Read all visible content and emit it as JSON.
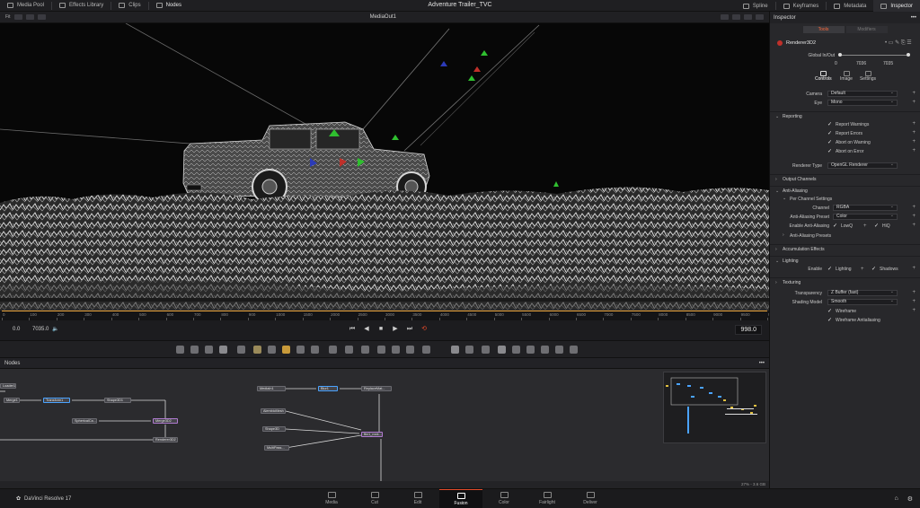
{
  "topbar": {
    "items": [
      {
        "label": "Media Pool",
        "icon": "media-pool-icon"
      },
      {
        "label": "Effects Library",
        "icon": "effects-library-icon"
      },
      {
        "label": "Clips",
        "icon": "clips-icon"
      },
      {
        "label": "Nodes",
        "icon": "nodes-icon"
      }
    ],
    "project_title": "Adventure Trailer_TVC",
    "right_items": [
      {
        "label": "Spline",
        "icon": "spline-icon"
      },
      {
        "label": "Keyframes",
        "icon": "keyframes-icon"
      },
      {
        "label": "Metadata",
        "icon": "metadata-icon"
      },
      {
        "label": "Inspector",
        "icon": "inspector-icon"
      }
    ]
  },
  "viewer": {
    "zoom_label": "Fit",
    "title": "MediaOut1"
  },
  "ruler": {
    "ticks": [
      "0",
      "100",
      "200",
      "300",
      "400",
      "500",
      "600",
      "700",
      "800",
      "900",
      "1000",
      "1500",
      "2000",
      "2500",
      "3000",
      "3500",
      "4000",
      "4500",
      "5000",
      "5500",
      "6000",
      "6500",
      "7000",
      "7500",
      "8000",
      "8500",
      "9000",
      "9500",
      "9800"
    ]
  },
  "transport": {
    "start": "0.0",
    "end": "7035.0",
    "current": "998.0"
  },
  "nodes_panel": {
    "title": "Nodes",
    "nodes": [
      "Loader1",
      "Merge1",
      "Transform1",
      "Shape3D1",
      "Merge3D2",
      "SphericalCa...",
      "Renderer3D2",
      "MediaIn1",
      "Blur1",
      "ReplaceMat...",
      "AlembicMesh",
      "Shape3D",
      "MultiPass...",
      "fbx1_rock..."
    ],
    "status": "27% - 3.6 GB"
  },
  "inspector": {
    "title": "Inspector",
    "tabs": [
      "Tools",
      "Modifiers"
    ],
    "node_name": "Renderer3D2",
    "global_label": "Global In/Out",
    "global_vals": [
      "0",
      "7036",
      "7035"
    ],
    "subtabs": [
      "Controls",
      "Image",
      "Settings"
    ],
    "camera_label": "Camera",
    "camera_value": "Default",
    "eye_label": "Eye",
    "eye_value": "Mono",
    "reporting_label": "Reporting",
    "reporting": [
      "Report Warnings",
      "Report Errors",
      "Abort on Warning",
      "Abort on Error"
    ],
    "renderer_type_label": "Renderer Type",
    "renderer_type_value": "OpenGL Renderer",
    "output_channels": "Output Channels",
    "anti_aliasing": "Anti-Aliasing",
    "per_channel": "Per Channel Settings",
    "channel_label": "Channel",
    "channel_value": "RGBA",
    "aa_preset_label": "Anti-Aliasing Preset",
    "aa_preset_value": "Color",
    "enable_aa_label": "Enable Anti-Aliasing",
    "lowq": "LowQ",
    "hiq": "HiQ",
    "aa_presets": "Anti-Aliasing Presets",
    "accumulation": "Accumulation Effects",
    "lighting": "Lighting",
    "enable_label": "Enable",
    "lighting_cb": "Lighting",
    "shadows_cb": "Shadows",
    "texturing": "Texturing",
    "transparency_label": "Transparency",
    "transparency_value": "Z Buffer (fast)",
    "shading_label": "Shading Model",
    "shading_value": "Smooth",
    "wireframe": "Wireframe",
    "wireframe_aa": "Wireframe Antialiasing"
  },
  "pagebar": {
    "brand": "DaVinci Resolve 17",
    "pages": [
      "Media",
      "Cut",
      "Edit",
      "Fusion",
      "Color",
      "Fairlight",
      "Deliver"
    ],
    "active_page": "Fusion"
  }
}
